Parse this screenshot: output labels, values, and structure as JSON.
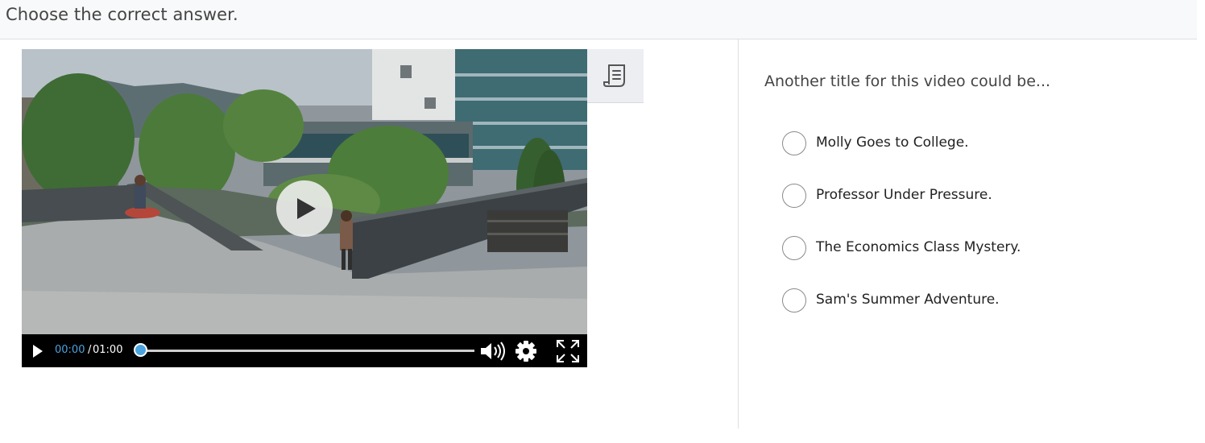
{
  "instruction": "Choose the correct answer.",
  "question": "Another title for this video could be...",
  "options": [
    {
      "label": "Molly Goes to College."
    },
    {
      "label": "Professor Under Pressure."
    },
    {
      "label": "The Economics Class Mystery."
    },
    {
      "label": "Sam's Summer Adventure."
    }
  ],
  "player": {
    "current_time": "00:00",
    "separator": "/",
    "total_time": "01:00",
    "progress": 0,
    "accent_color": "#4aa3df"
  },
  "icons": {
    "transcript": "transcript-icon",
    "play": "play-icon",
    "volume": "volume-icon",
    "settings": "gear-icon",
    "fullscreen": "fullscreen-icon"
  }
}
